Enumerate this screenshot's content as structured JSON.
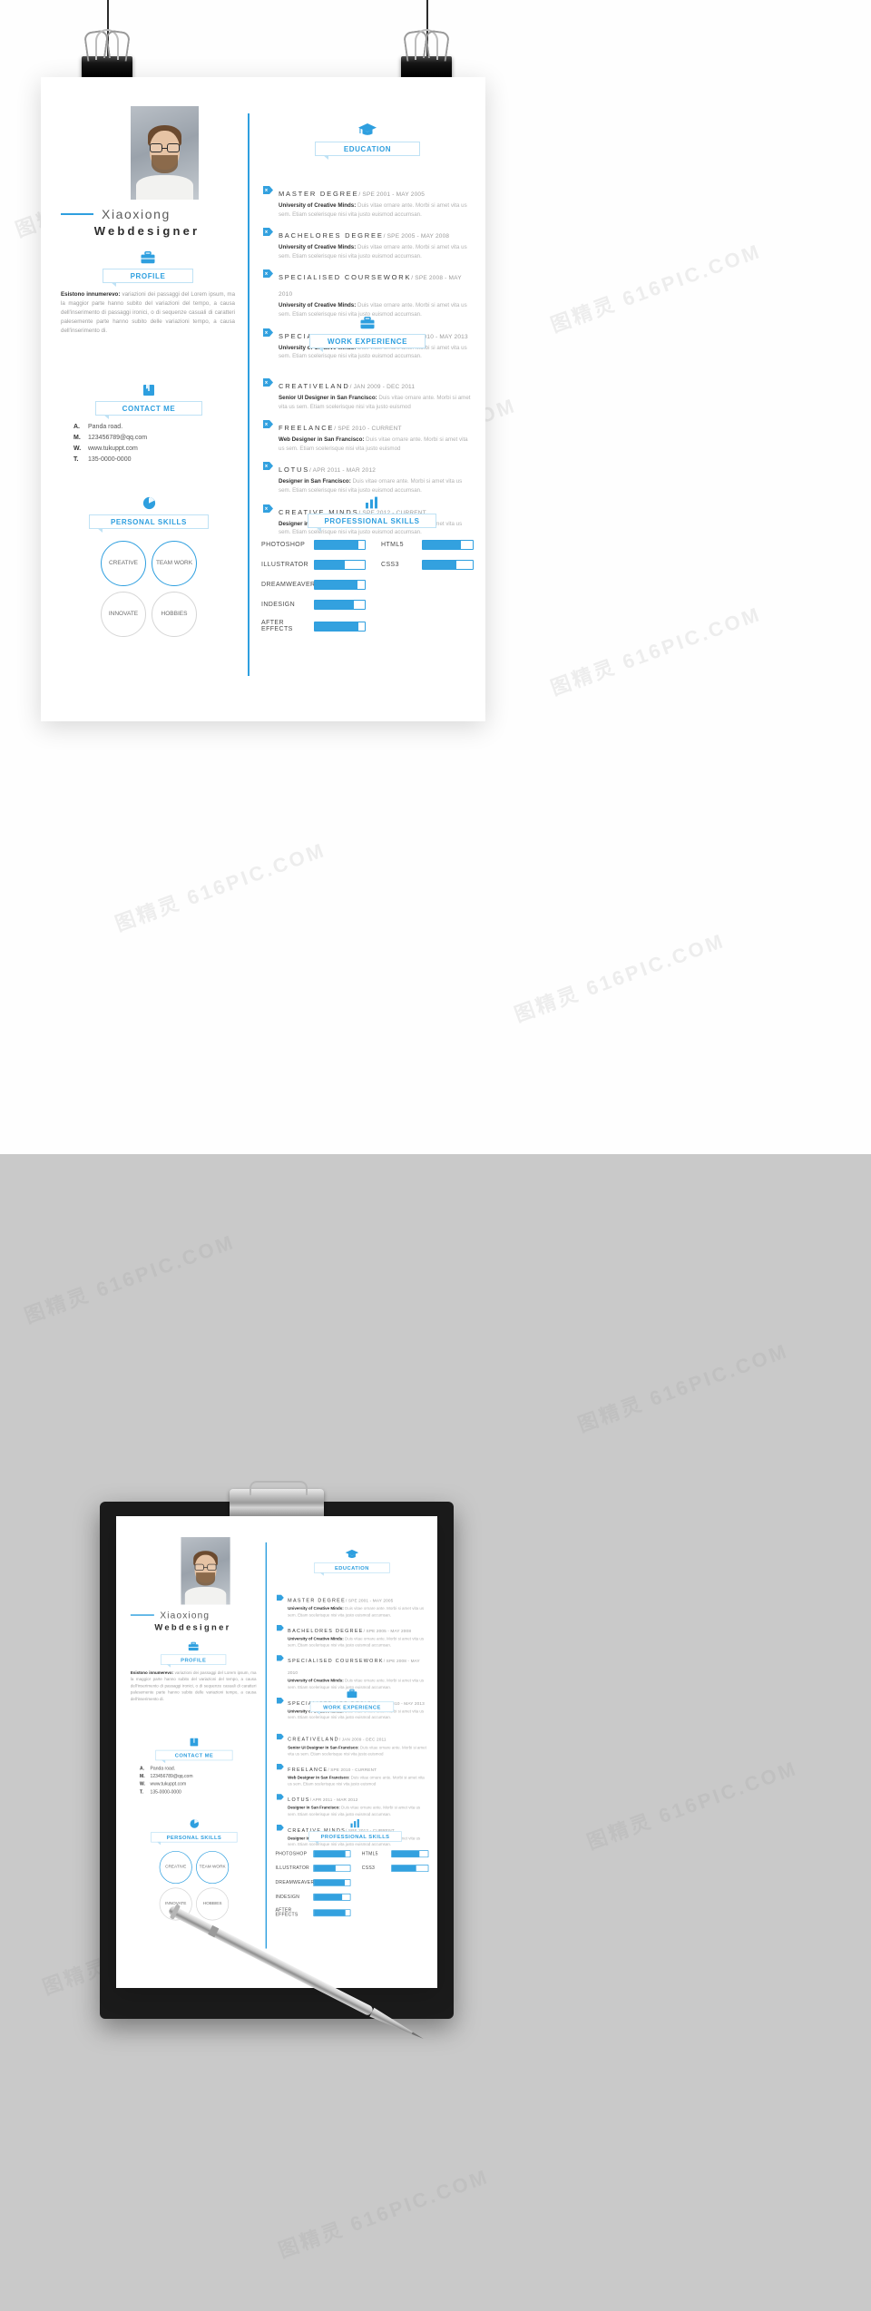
{
  "person": {
    "name": "Xiaoxiong",
    "title": "Webdesigner"
  },
  "sections": {
    "profile": {
      "label": "PROFILE",
      "icon": "briefcase-icon"
    },
    "contact": {
      "label": "CONTACT ME",
      "icon": "book-icon"
    },
    "personal_skills": {
      "label": "PERSONAL SKILLS",
      "icon": "pie-chart-icon"
    },
    "education": {
      "label": "EDUCATION",
      "icon": "graduation-cap-icon"
    },
    "work": {
      "label": "WORK EXPERIENCE",
      "icon": "suitcase-icon"
    },
    "professional_skills": {
      "label": "PROFESSIONAL SKILLS",
      "icon": "bar-chart-icon"
    }
  },
  "profile": {
    "lead": "Esistono innumerevo:",
    "text": " variazioni dei passaggi del Lorem ipsum, ma la maggior parte hanno subito del variazioni del tempo, a causa dell'inserimento di passaggi ironici, o di sequenze casuali di caratteri palesemente parte hanno subito delle variazioni tempo, a causa dell'inserimento di."
  },
  "contact": [
    {
      "key": "A.",
      "value": "Panda road."
    },
    {
      "key": "M.",
      "value": "123456789@qq.com"
    },
    {
      "key": "W.",
      "value": "www.tukuppt.com"
    },
    {
      "key": "T.",
      "value": "135-0000-0000"
    }
  ],
  "personal_skills": [
    {
      "label": "CREATIVE"
    },
    {
      "label": "TEAM WORK"
    },
    {
      "label": "INNOVATE"
    },
    {
      "label": "HOBBIES"
    }
  ],
  "education": [
    {
      "title": "MASTER DEGREE",
      "date": "/ SPE 2001 - MAY 2005",
      "org": "University of Creative Minds:",
      "desc": " Duis vitae ornare ante. Morbi si amet vita us sem. Etiam scelerisque nisi vita justo euismod accumsan."
    },
    {
      "title": "BACHELORES DEGREE",
      "date": "/ SPE 2005 - MAY 2008",
      "org": "University of Creative Minds:",
      "desc": " Duis vitae ornare ante. Morbi si amet vita us sem. Etiam scelerisque nisi vita justo euismod accumsan."
    },
    {
      "title": "SPECIALISED COURSEWORK",
      "date": "/ SPE 2008 - MAY 2010",
      "org": "University of Creative Minds:",
      "desc": " Duis vitae ornare ante. Morbi si amet vita us sem. Etiam scelerisque nisi vita justo euismod accumsan."
    },
    {
      "title": "SPECIALISED APP DESIGN",
      "date": "/ SPE 2010 - MAY 2013",
      "org": "University of Creative Minds:",
      "desc": " Duis vitae ornare ante. Morbi si amet vita us sem. Etiam scelerisque nisi vita justo euismod accumsan."
    }
  ],
  "work": [
    {
      "title": "CREATIVELAND",
      "date": "/ JAN 2009 - DEC 2011",
      "org": "Senior UI Designer in San Francisco:",
      "desc": " Duis vitae ornare ante. Morbi si amet vita us sem. Etiam scelerisque nisi vita justo euismod"
    },
    {
      "title": "FREELANCE",
      "date": "/ SPE 2010 - CURRENT",
      "org": "Web Designer in San Francisco:",
      "desc": " Duis vitae ornare ante. Morbi si amet vita us sem. Etiam scelerisque nisi vita justo euismod"
    },
    {
      "title": "LOTUS",
      "date": "/ APR 2011 - MAR 2012",
      "org": "Designer in San Francisco:",
      "desc": " Duis vitae ornare ante. Morbi si amet vita us sem. Etiam scelerisque nisi vita justo euismod accumsan."
    },
    {
      "title": "CREATIVE MINDS",
      "date": "/ SPE 2012 - CURRENT",
      "org": "Designer in San Francisco:",
      "desc": " Duis vitae ornare ante. Morbi si amet vita us sem. Etiam scelerisque nisi vita justo euismod accumsan."
    }
  ],
  "professional_skills": {
    "left": [
      {
        "label": "PHOTOSHOP",
        "percent": 88
      },
      {
        "label": "ILLUSTRATOR",
        "percent": 60
      },
      {
        "label": "DREAMWEAVER",
        "percent": 86
      },
      {
        "label": "INDESIGN",
        "percent": 78
      },
      {
        "label": "AFTER EFFECTS",
        "percent": 87
      }
    ],
    "right": [
      {
        "label": "HTML5",
        "percent": 76
      },
      {
        "label": "CSS3",
        "percent": 68
      }
    ]
  },
  "colors": {
    "accent": "#2e9fdf",
    "accent_light": "#bfe2f5",
    "text_dark": "#2e2e2e",
    "text_muted": "#b2b2b2",
    "page_bg_bottom": "#c9c9c9",
    "clipboard": "#1b1b1b"
  },
  "watermark": {
    "text": "图精灵 616PIC.COM"
  }
}
